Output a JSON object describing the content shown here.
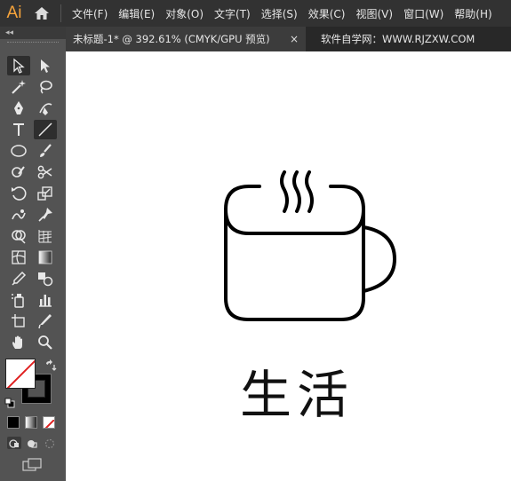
{
  "app": {
    "logo": "Ai"
  },
  "menu": {
    "items": [
      {
        "label": "文件(F)"
      },
      {
        "label": "编辑(E)"
      },
      {
        "label": "对象(O)"
      },
      {
        "label": "文字(T)"
      },
      {
        "label": "选择(S)"
      },
      {
        "label": "效果(C)"
      },
      {
        "label": "视图(V)"
      },
      {
        "label": "窗口(W)"
      },
      {
        "label": "帮助(H)"
      }
    ]
  },
  "toolbar": {
    "collapse_label": "◂◂"
  },
  "tabs": {
    "active": "未标题-1* @ 392.61% (CMYK/GPU 预览)",
    "close_glyph": "×",
    "second": "软件自学网：WWW.RJZXW.COM"
  },
  "artwork": {
    "label": "生活",
    "icon": "coffee-cup-icon"
  },
  "colors": {
    "menubar": "#323232",
    "panel": "#535353",
    "logo": "#f7a43b",
    "no_fill": "#e02020"
  }
}
